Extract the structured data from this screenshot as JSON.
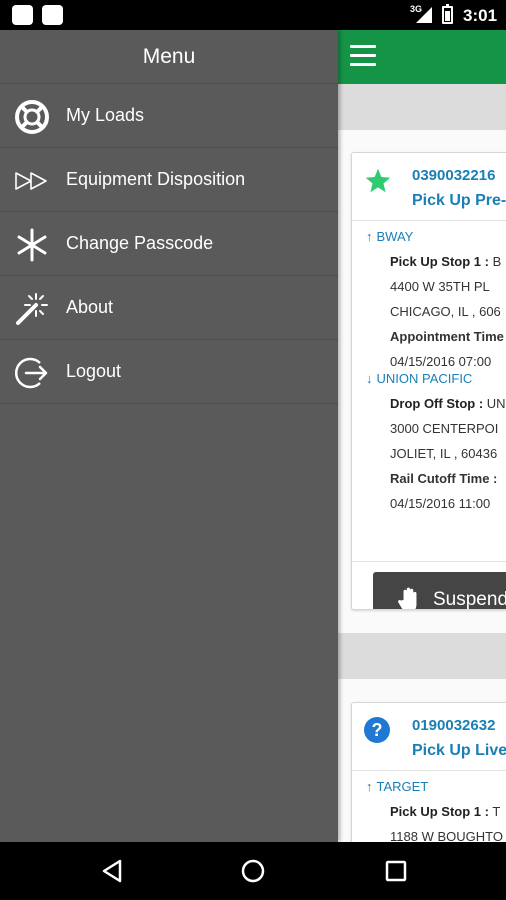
{
  "status_bar": {
    "network": "3G",
    "time": "3:01"
  },
  "drawer": {
    "title": "Menu",
    "items": [
      {
        "label": "My Loads",
        "icon": "lifebuoy-icon"
      },
      {
        "label": "Equipment Disposition",
        "icon": "fast-forward-icon"
      },
      {
        "label": "Change Passcode",
        "icon": "asterisk-icon"
      },
      {
        "label": "About",
        "icon": "magic-wand-icon"
      },
      {
        "label": "Logout",
        "icon": "logout-icon"
      }
    ]
  },
  "loads": [
    {
      "number": "0390032216",
      "status": "Pick Up Pre-",
      "status_icon": "star-icon",
      "stops": [
        {
          "name": "BWAY",
          "direction": "up",
          "label": "Pick Up Stop 1 :",
          "label_value": "B",
          "address": "4400 W 35TH PL",
          "city": "CHICAGO, IL , 606",
          "time_label": "Appointment Time",
          "time_value": "04/15/2016 07:00"
        },
        {
          "name": "UNION PACIFIC",
          "direction": "down",
          "label": "Drop Off Stop :",
          "label_value": "UN",
          "address": "3000 CENTERPOI",
          "city": "JOLIET, IL , 60436",
          "time_label": "Rail Cutoff Time :",
          "time_value": "04/15/2016 11:00"
        }
      ],
      "action_label": "Suspend"
    },
    {
      "number": "0190032632",
      "status": "Pick Up Live",
      "status_icon": "help-icon",
      "stops": [
        {
          "name": "TARGET",
          "direction": "up",
          "label": "Pick Up Stop 1 :",
          "label_value": "T",
          "address": "1188 W BOUGHTO"
        }
      ]
    }
  ],
  "colors": {
    "app_bar": "#159447",
    "drawer": "#5a5a5a",
    "link": "#1a7fb5",
    "star": "#2ecc71"
  }
}
